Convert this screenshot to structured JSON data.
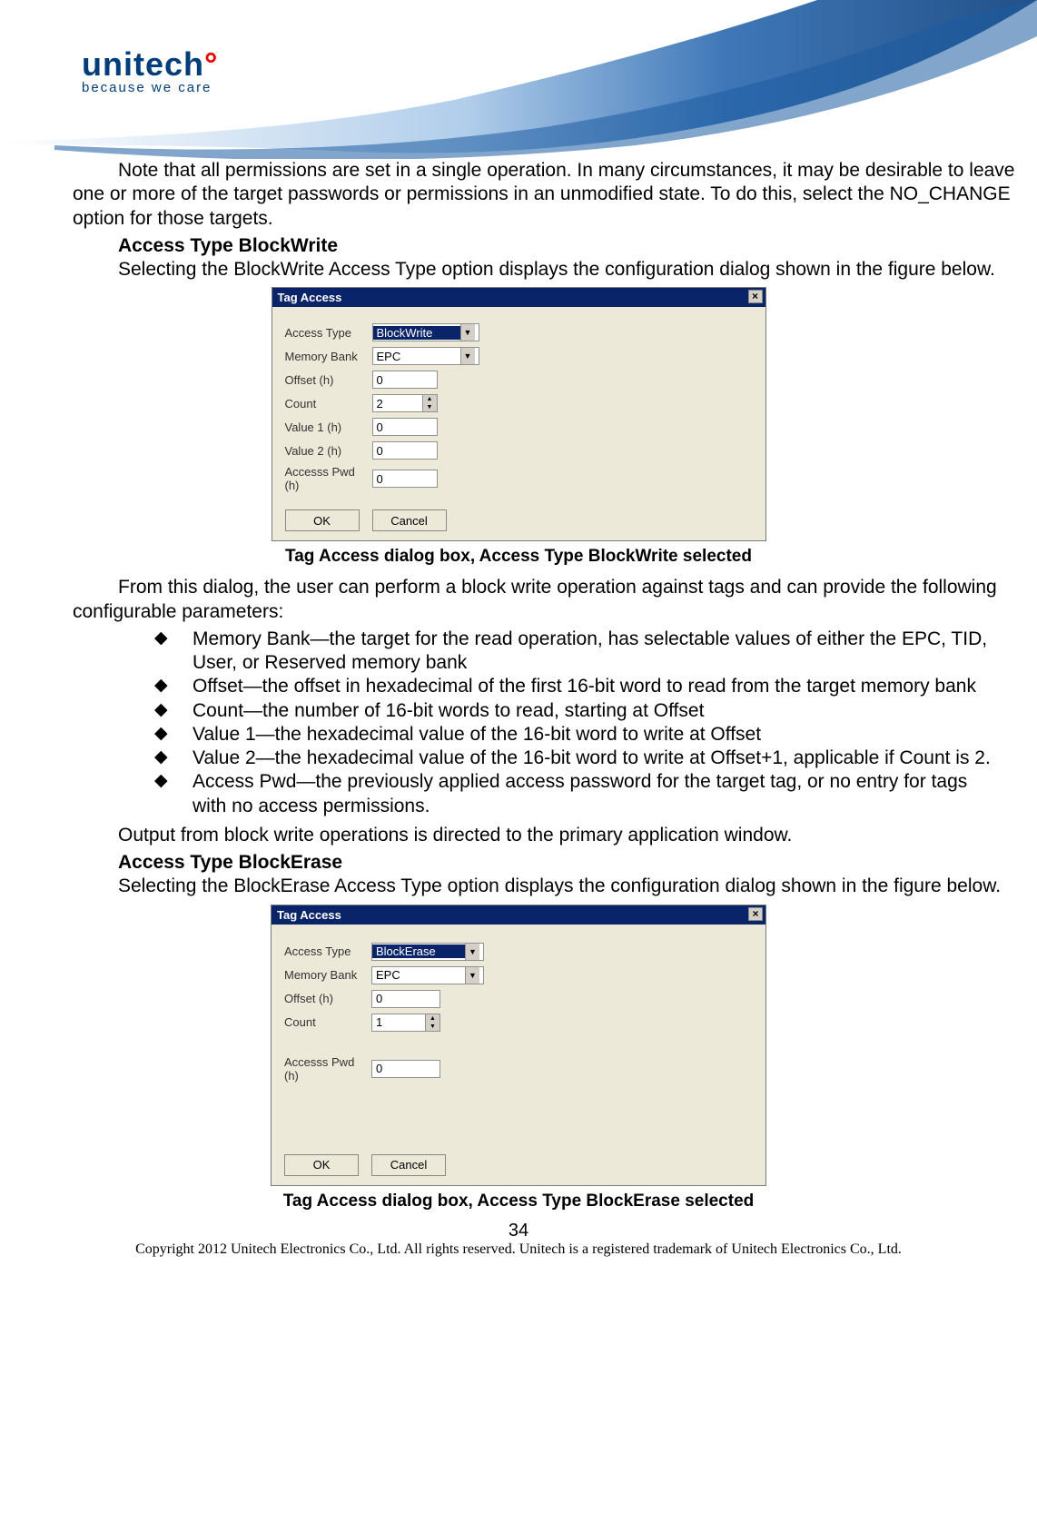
{
  "logo": {
    "brand": "unitech",
    "tagline": "because we care"
  },
  "intro_para": "Note that all permissions are set in a single operation. In many circumstances, it may be desirable to leave one or more of the target passwords or permissions in an unmodified state. To do this, select the NO_CHANGE option for those targets.",
  "section1": {
    "heading": "Access Type BlockWrite",
    "para": "Selecting the BlockWrite Access Type option displays the configuration dialog shown in the figure below."
  },
  "dialog1": {
    "title": "Tag Access",
    "close": "×",
    "labels": {
      "access_type": "Access Type",
      "memory_bank": "Memory Bank",
      "offset": "Offset (h)",
      "count": "Count",
      "value1": "Value 1 (h)",
      "value2": "Value 2 (h)",
      "access_pwd": "Accesss Pwd (h)"
    },
    "values": {
      "access_type": "BlockWrite",
      "memory_bank": "EPC",
      "offset": "0",
      "count": "2",
      "value1": "0",
      "value2": "0",
      "access_pwd": "0"
    },
    "buttons": {
      "ok": "OK",
      "cancel": "Cancel"
    }
  },
  "caption1": "Tag Access dialog box, Access Type BlockWrite selected",
  "para_after_dlg1": "From this dialog, the user can perform a block write operation against tags and can provide the following configurable parameters:",
  "bullets": [
    "Memory Bank—the target for the read operation, has selectable values of either the EPC, TID, User, or Reserved memory bank",
    "Offset—the offset in hexadecimal of the first 16-bit word to read from the target memory bank",
    "Count—the number of 16-bit words to read, starting at Offset",
    "Value 1—the hexadecimal value of the 16-bit word to write at Offset",
    "Value 2—the hexadecimal value of the 16-bit word to write at Offset+1, applicable if Count is 2.",
    "Access Pwd—the previously applied access password for the target tag, or no entry for tags with no access permissions."
  ],
  "output_para": "Output from block write operations is directed to the primary application window.",
  "section2": {
    "heading": "Access Type BlockErase",
    "para": "Selecting the BlockErase Access Type option displays the configuration dialog shown in the figure below."
  },
  "dialog2": {
    "title": "Tag Access",
    "close": "×",
    "labels": {
      "access_type": "Access Type",
      "memory_bank": "Memory Bank",
      "offset": "Offset (h)",
      "count": "Count",
      "access_pwd": "Accesss Pwd (h)"
    },
    "values": {
      "access_type": "BlockErase",
      "memory_bank": "EPC",
      "offset": "0",
      "count": "1",
      "access_pwd": "0"
    },
    "buttons": {
      "ok": "OK",
      "cancel": "Cancel"
    }
  },
  "caption2": "Tag Access dialog box, Access Type BlockErase selected",
  "page_number": "34",
  "copyright": "Copyright 2012 Unitech Electronics Co., Ltd. All rights reserved. Unitech is a registered trademark of Unitech Electronics Co., Ltd."
}
